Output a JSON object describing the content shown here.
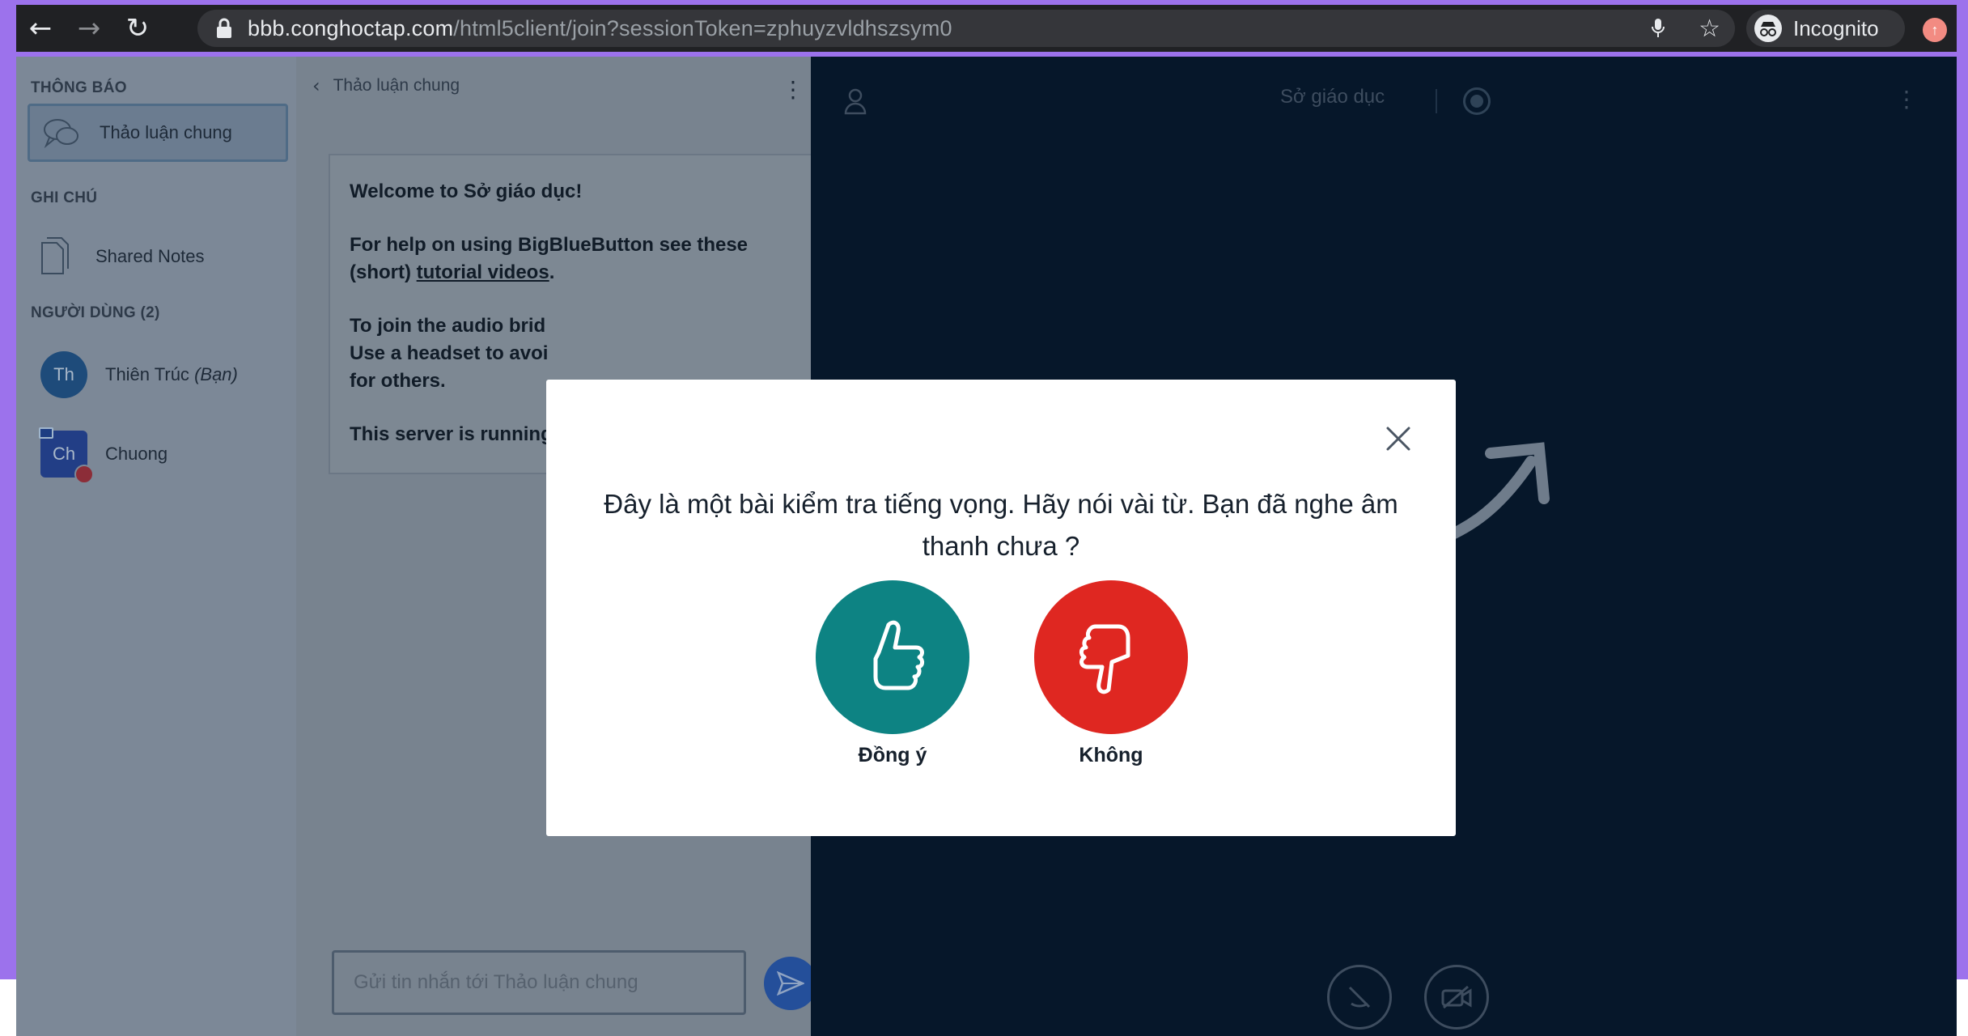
{
  "browser": {
    "url_host": "bbb.conghoctap.com",
    "url_path": "/html5client/join?sessionToken=zphuyzvldhszsym0",
    "profile_label": "Incognito"
  },
  "userlist": {
    "messages_title": "THÔNG BÁO",
    "public_chat_label": "Thảo luận chung",
    "notes_title": "GHI CHÚ",
    "shared_notes_label": "Shared Notes",
    "users_title": "NGƯỜI DÙNG (2)",
    "users": [
      {
        "initials": "Th",
        "name": "Thiên Trúc",
        "suffix": "(Bạn)"
      },
      {
        "initials": "Ch",
        "name": "Chuong"
      }
    ]
  },
  "chat": {
    "title": "Thảo luận chung",
    "welcome_prefix": "Welcome to ",
    "welcome_meeting": "Sở giáo dục",
    "welcome_suffix": "!",
    "help_text": "For help on using BigBlueButton see these (short) ",
    "help_link": "tutorial videos",
    "help_end": ".",
    "audio_text": "To join the audio brid",
    "audio_text_2": "Use a headset to avoi",
    "audio_text_3": "for others.",
    "server_text": "This server is running",
    "input_placeholder": "Gửi tin nhắn tới Thảo luận chung"
  },
  "presentation": {
    "meeting_title": "Sở giáo dục"
  },
  "modal": {
    "question": "Đây là một bài kiểm tra tiếng vọng. Hãy nói vài từ. Bạn đã nghe âm thanh chưa ?",
    "yes_label": "Đồng ý",
    "no_label": "Không"
  },
  "colors": {
    "yes_button": "#0d8383",
    "no_button": "#df2721",
    "app_background": "#06172a",
    "overlay_panel": "#7c8897",
    "desktop_background": "#9c72ec"
  },
  "icons": [
    "back-icon",
    "forward-icon",
    "reload-icon",
    "lock-icon",
    "mic-icon",
    "star-icon",
    "incognito-icon",
    "chat-bubbles-icon",
    "notes-icon",
    "chevron-left-icon",
    "kebab-menu-icon",
    "send-icon",
    "user-icon",
    "record-icon",
    "close-icon",
    "thumbs-up-icon",
    "thumbs-down-icon",
    "phone-off-icon",
    "camera-off-icon"
  ]
}
